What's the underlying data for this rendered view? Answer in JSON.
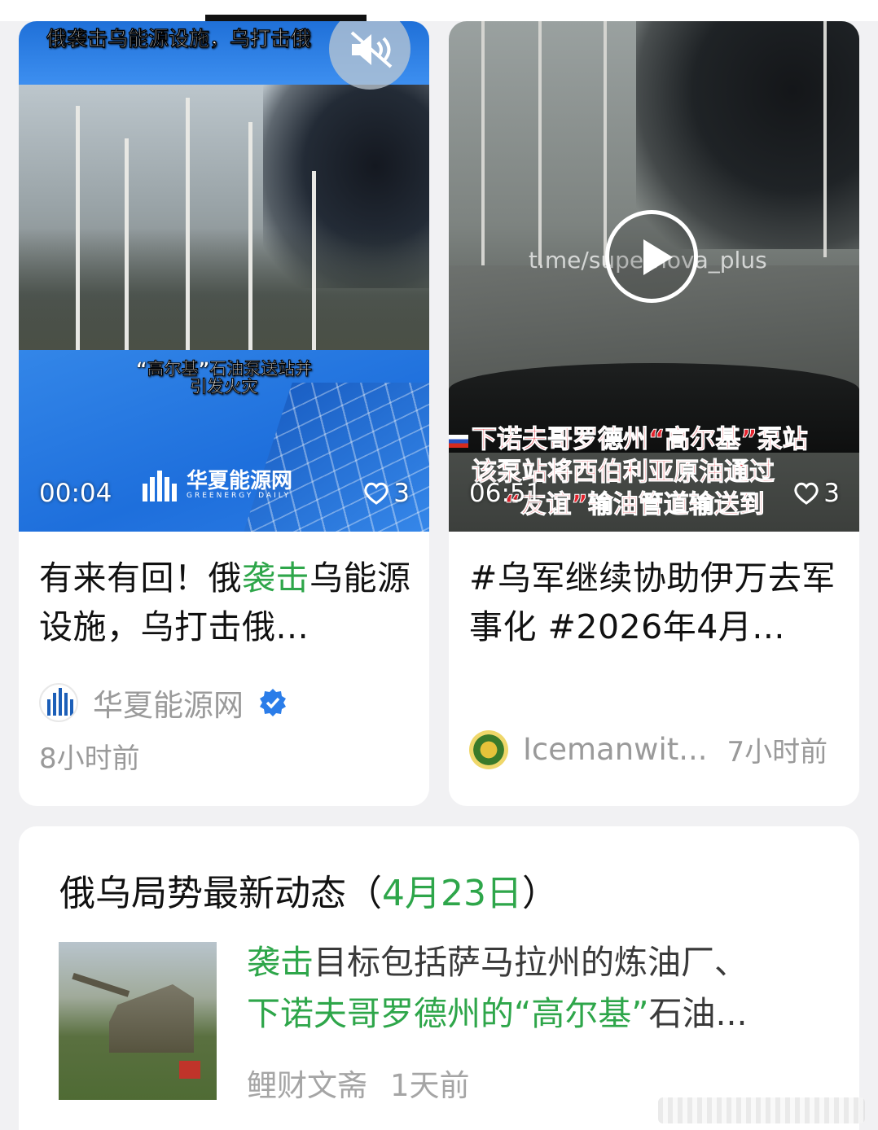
{
  "cards": [
    {
      "video_caption_top": "俄袭击乌能源设施，乌打击俄",
      "video_subtitle_line1": "“高尔基”石油泵送站并",
      "video_subtitle_line2": "引发火灾",
      "logo_text": "华夏能源网",
      "logo_subtext": "GREENERGY DAILY",
      "duration": "00:04",
      "likes": "3",
      "title_part1": "有来有回！俄",
      "title_highlight": "袭击",
      "title_part2": "乌能源设施，乌打击俄...",
      "author": "华夏能源网",
      "time": "8小时前"
    },
    {
      "watermark": "t.me/supernova_plus",
      "red_caption_line1": "下诺夫哥罗德州“高尔基”泵站",
      "red_caption_line2": "该泵站将西伯利亚原油通过",
      "red_caption_line3": "“友谊”输油管道输送到",
      "duration": "06:51",
      "likes": "3",
      "title": "#乌军继续协助伊万去军事化 #2026年4月...",
      "author": "Icemanwit...",
      "time": "7小时前"
    }
  ],
  "news": {
    "title_prefix": "俄乌局势最新动态（",
    "title_date": "4月23日",
    "title_suffix": "）",
    "text_hl1": "袭击",
    "text_1": "目标包括萨马拉州的炼油厂、",
    "text_hl2": "下诺夫哥罗德州的“高尔基”",
    "text_2": "石油...",
    "source": "鲤财文斋",
    "time": "1天前"
  },
  "colors": {
    "highlight": "#2ea64a",
    "verified": "#2b7de9",
    "meta_text": "#9a9a9a"
  },
  "icons": [
    "mute-icon",
    "heart-icon",
    "play-icon",
    "verified-icon"
  ]
}
